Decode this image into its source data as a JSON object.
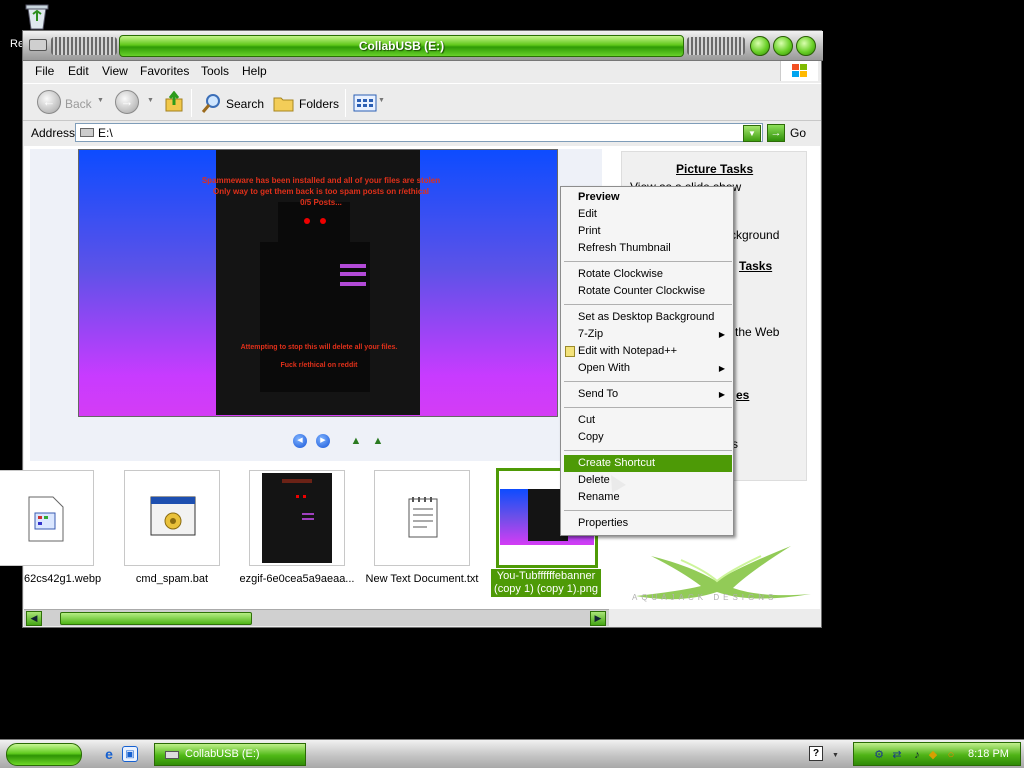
{
  "desktop": {
    "recycle_label": "Re"
  },
  "window": {
    "title": "CollabUSB (E:)",
    "menu": [
      "File",
      "Edit",
      "View",
      "Favorites",
      "Tools",
      "Help"
    ],
    "toolbar": {
      "back": "Back",
      "search": "Search",
      "folders": "Folders"
    },
    "address": {
      "label": "Address",
      "value": "E:\\",
      "go": "Go"
    }
  },
  "preview": {
    "ransom_line1": "Spammeware has been installed and all of your files are stolen",
    "ransom_line2": "Only way to get them back is too spam posts on r/ethical",
    "ransom_line3": "0/5 Posts...",
    "ransom_line4": "Attempting to stop this will delete all your files.",
    "ransom_line5": "Fuck r/ethical on reddit"
  },
  "tasks": {
    "picture_tasks": "Picture Tasks",
    "view_slideshow": "View as a slide show",
    "background_frag": "ckground",
    "file_tasks_frag": "Tasks",
    "web_frag": "the Web",
    "places_frag": "es",
    "details_frag": "s",
    "xlogo_text": "AQUAJACK DESIGNS"
  },
  "thumbnails": [
    {
      "label": "62cs42g1.webp"
    },
    {
      "label": "cmd_spam.bat"
    },
    {
      "label": "ezgif-6e0cea5a9aeaa..."
    },
    {
      "label": "New Text Document.txt"
    },
    {
      "label": "You-Tubffffffebanner (copy 1) (copy 1).png"
    }
  ],
  "context_menu": {
    "preview": "Preview",
    "edit": "Edit",
    "print": "Print",
    "refresh": "Refresh Thumbnail",
    "rotate_cw": "Rotate Clockwise",
    "rotate_ccw": "Rotate Counter Clockwise",
    "set_bg": "Set as Desktop Background",
    "zip": "7-Zip",
    "notepad": "Edit with Notepad++",
    "open_with": "Open With",
    "send_to": "Send To",
    "cut": "Cut",
    "copy": "Copy",
    "create_shortcut": "Create Shortcut",
    "delete": "Delete",
    "rename": "Rename",
    "properties": "Properties"
  },
  "taskbar": {
    "window_button": "CollabUSB (E:)",
    "clock": "8:18 PM"
  },
  "colors": {
    "accent_green": "#4d9a06",
    "desktop": "#000000"
  }
}
